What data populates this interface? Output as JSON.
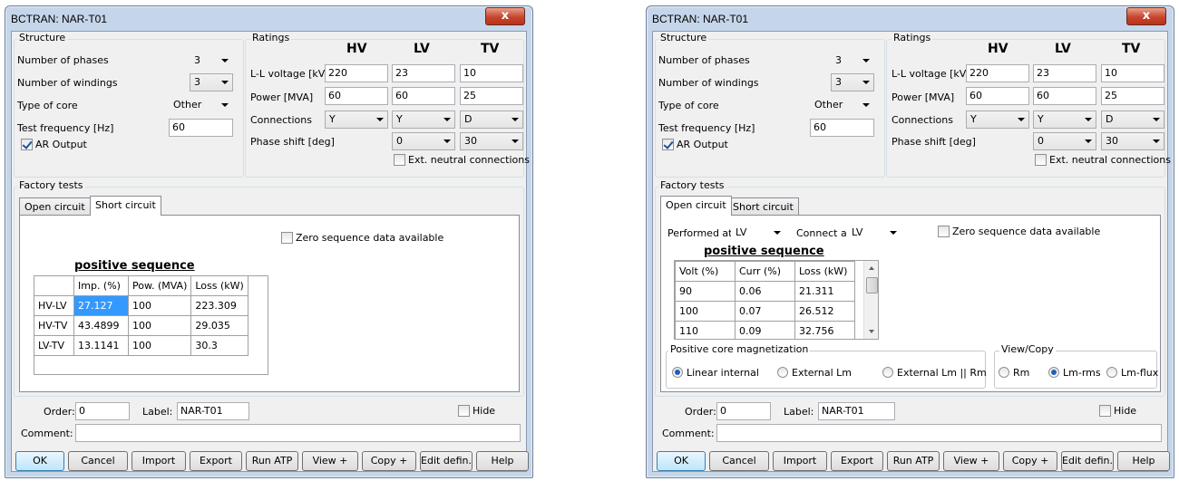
{
  "window_left": {
    "title": "BCTRAN: NAR-T01",
    "close": "x",
    "structure": {
      "legend": "Structure",
      "phases_label": "Number of phases",
      "phases_value": "3",
      "windings_label": "Number of windings",
      "windings_value": "3",
      "core_label": "Type of core",
      "core_value": "Other",
      "freq_label": "Test frequency [Hz]",
      "freq_value": "60",
      "ar_label": "AR Output"
    },
    "ratings": {
      "legend": "Ratings",
      "hv": "HV",
      "lv": "LV",
      "tv": "TV",
      "voltage_label": "L-L voltage [kV]",
      "voltage": [
        "220",
        "23",
        "10"
      ],
      "power_label": "Power [MVA]",
      "power": [
        "60",
        "60",
        "25"
      ],
      "conn_label": "Connections",
      "conn": [
        "Y",
        "Y",
        "D"
      ],
      "shift_label": "Phase shift [deg]",
      "shift": [
        "0",
        "30"
      ],
      "ext_label": "Ext. neutral connections"
    },
    "factory": {
      "legend": "Factory tests",
      "tab_open": "Open circuit",
      "tab_short": "Short circuit",
      "zero_label": "Zero sequence data available",
      "seq_title": "positive sequence",
      "headers": [
        "",
        "Imp. (%)",
        "Pow. (MVA)",
        "Loss (kW)"
      ],
      "rows": [
        [
          "HV-LV",
          "27.127",
          "100",
          "223.309"
        ],
        [
          "HV-TV",
          "43.4899",
          "100",
          "29.035"
        ],
        [
          "LV-TV",
          "13.1141",
          "100",
          "30.3"
        ]
      ]
    },
    "order_label": "Order:",
    "order_value": "0",
    "label_label": "Label:",
    "label_value": "NAR-T01",
    "hide_label": "Hide",
    "comment_label": "Comment:",
    "buttons": [
      "OK",
      "Cancel",
      "Import",
      "Export",
      "Run ATP",
      "View +",
      "Copy +",
      "Edit defin.",
      "Help"
    ]
  },
  "window_right": {
    "title": "BCTRAN: NAR-T01",
    "close": "x",
    "structure": {
      "legend": "Structure",
      "phases_label": "Number of phases",
      "phases_value": "3",
      "windings_label": "Number of windings",
      "windings_value": "3",
      "core_label": "Type of core",
      "core_value": "Other",
      "freq_label": "Test frequency [Hz]",
      "freq_value": "60",
      "ar_label": "AR Output"
    },
    "ratings": {
      "legend": "Ratings",
      "hv": "HV",
      "lv": "LV",
      "tv": "TV",
      "voltage_label": "L-L voltage [kV]",
      "voltage": [
        "220",
        "23",
        "10"
      ],
      "power_label": "Power [MVA]",
      "power": [
        "60",
        "60",
        "25"
      ],
      "conn_label": "Connections",
      "conn": [
        "Y",
        "Y",
        "D"
      ],
      "shift_label": "Phase shift [deg]",
      "shift": [
        "0",
        "30"
      ],
      "ext_label": "Ext. neutral connections"
    },
    "factory": {
      "legend": "Factory tests",
      "tab_open": "Open circuit",
      "tab_short": "Short circuit",
      "performed_label": "Performed at",
      "performed_value": "LV",
      "connect_label": "Connect at",
      "connect_value": "LV",
      "zero_label": "Zero sequence data available",
      "seq_title": "positive sequence",
      "headers": [
        "Volt (%)",
        "Curr (%)",
        "Loss (kW)"
      ],
      "rows": [
        [
          "90",
          "0.06",
          "21.311"
        ],
        [
          "100",
          "0.07",
          "26.512"
        ],
        [
          "110",
          "0.09",
          "32.756"
        ]
      ],
      "core_legend": "Positive core magnetization",
      "core_opts": [
        "Linear internal",
        "External Lm",
        "External  Lm || Rm"
      ],
      "view_legend": "View/Copy",
      "view_opts": [
        "Rm",
        "Lm-rms",
        "Lm-flux"
      ]
    },
    "order_label": "Order:",
    "order_value": "0",
    "label_label": "Label:",
    "label_value": "NAR-T01",
    "hide_label": "Hide",
    "comment_label": "Comment:",
    "buttons": [
      "OK",
      "Cancel",
      "Import",
      "Export",
      "Run ATP",
      "View +",
      "Copy +",
      "Edit defin.",
      "Help"
    ]
  }
}
